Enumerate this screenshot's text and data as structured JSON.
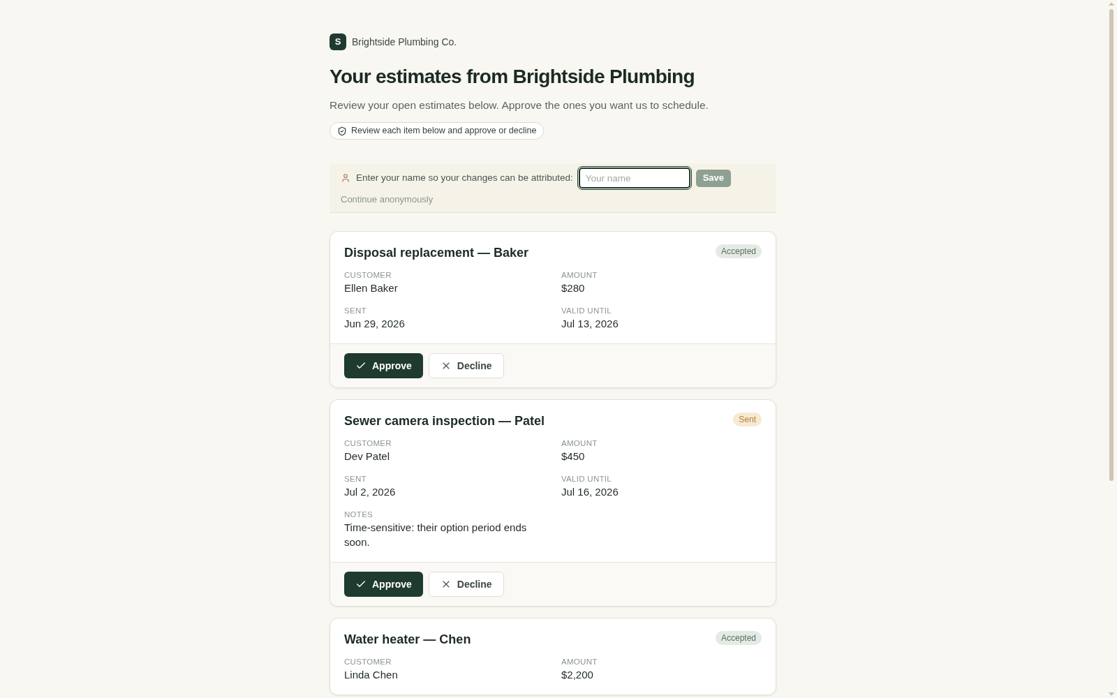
{
  "brand": {
    "logo_letter": "S",
    "name": "Brightside Plumbing Co."
  },
  "heading": "Your estimates from Brightside Plumbing",
  "subheading": "Review your open estimates below. Approve the ones you want us to schedule.",
  "notice_pill": "Review each item below and approve or decline",
  "name_prompt": {
    "label": "Enter your name so your changes can be attributed:",
    "placeholder": "Your name",
    "focused": true,
    "save_button": {
      "label": "Save",
      "disabled": true
    },
    "skip_link": "Continue anonymously"
  },
  "estimates": [
    {
      "title": "Disposal replacement — Baker",
      "status": {
        "label": "Accepted",
        "kind": "accepted"
      },
      "fields": [
        {
          "label": "CUSTOMER",
          "value": "Ellen Baker"
        },
        {
          "label": "AMOUNT",
          "value": "$280"
        },
        {
          "label": "SENT",
          "value": "Jun 29, 2026"
        },
        {
          "label": "VALID UNTIL",
          "value": "Jul 13, 2026"
        }
      ],
      "actions": [
        {
          "label": "Approve",
          "kind": "approve"
        },
        {
          "label": "Decline",
          "kind": "decline"
        }
      ]
    },
    {
      "title": "Sewer camera inspection — Patel",
      "status": {
        "label": "Sent",
        "kind": "sent"
      },
      "fields": [
        {
          "label": "CUSTOMER",
          "value": "Dev Patel"
        },
        {
          "label": "AMOUNT",
          "value": "$450"
        },
        {
          "label": "SENT",
          "value": "Jul 2, 2026"
        },
        {
          "label": "VALID UNTIL",
          "value": "Jul 16, 2026"
        },
        {
          "label": "NOTES",
          "value": "Time-sensitive: their option period ends soon."
        }
      ],
      "actions": [
        {
          "label": "Approve",
          "kind": "approve"
        },
        {
          "label": "Decline",
          "kind": "decline"
        }
      ]
    },
    {
      "title": "Water heater — Chen",
      "status": {
        "label": "Accepted",
        "kind": "accepted"
      },
      "fields": [
        {
          "label": "CUSTOMER",
          "value": "Linda Chen"
        },
        {
          "label": "AMOUNT",
          "value": "$2,200"
        }
      ]
    }
  ]
}
